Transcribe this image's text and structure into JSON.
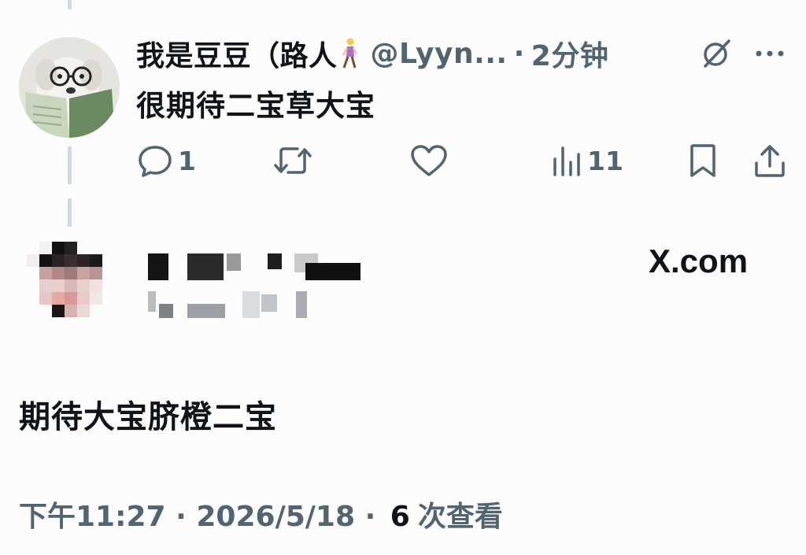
{
  "reply": {
    "display_name": "我是豆豆（路人",
    "name_emoji": "woman-walking-emoji",
    "handle": "@Lyyn...",
    "separator": "·",
    "time": "2分钟",
    "text": "很期待二宝草大宝",
    "actions": {
      "reply_count": "1",
      "retweet_count": "",
      "like_count": "",
      "views_count": "11"
    }
  },
  "quote": {
    "site": "X.com",
    "text": "期待大宝脐橙二宝"
  },
  "meta": {
    "time": "下午11:27",
    "sep1": "·",
    "date": "2026/5/18",
    "sep2": "·",
    "views_number": "6",
    "views_label": "次查看"
  },
  "colors": {
    "text": "#0f1419",
    "secondary": "#536471",
    "thread_line": "#cfd9de",
    "background": "#fdfcfd"
  }
}
